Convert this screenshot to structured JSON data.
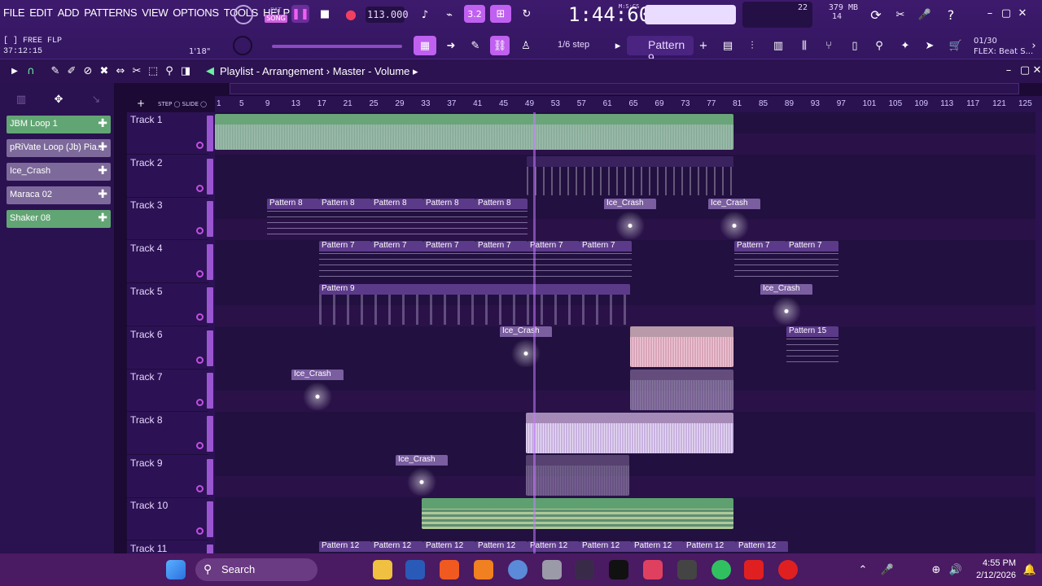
{
  "menu": [
    "FILE",
    "EDIT",
    "ADD",
    "PATTERNS",
    "VIEW",
    "OPTIONS",
    "TOOLS",
    "HELP"
  ],
  "transport": {
    "mode_top": "PAT",
    "mode_bottom": "SONG",
    "tempo": "113.000",
    "time": "1:44:60",
    "time_label": "M:S:CS",
    "time_format": "3.2",
    "cpu_top": "22",
    "ram": "379 MB",
    "ram_low": "14"
  },
  "hint": {
    "line1": "[  ] FREE FLP",
    "line2": "37:12:15",
    "line3": "1'18\""
  },
  "snap": {
    "step": "1/6 step",
    "pattern": "Pattern 9"
  },
  "news": {
    "count": "01/30",
    "text": "FLEX: Beat S..."
  },
  "playlist": {
    "breadcrumb_1": "Playlist - Arrangement",
    "breadcrumb_2": "Master - Volume"
  },
  "picker": [
    {
      "name": "JBM Loop 1"
    },
    {
      "name": "pRiVate Loop (Jb) Pia..."
    },
    {
      "name": "Ice_Crash"
    },
    {
      "name": "Maraca 02"
    },
    {
      "name": "Shaker 08"
    }
  ],
  "ruler": [
    "1",
    "5",
    "9",
    "13",
    "17",
    "21",
    "25",
    "29",
    "33",
    "37",
    "41",
    "45",
    "49",
    "53",
    "57",
    "61",
    "65",
    "69",
    "73",
    "77",
    "81",
    "85",
    "89",
    "93",
    "97",
    "101",
    "105",
    "109",
    "113",
    "117",
    "121",
    "125"
  ],
  "tracks": [
    "Track 1",
    "Track 2",
    "Track 3",
    "Track 4",
    "Track 5",
    "Track 6",
    "Track 7",
    "Track 8",
    "Track 9",
    "Track 10",
    "Track 11"
  ],
  "clips": {
    "p8": "Pattern 8",
    "p7": "Pattern 7",
    "p9": "Pattern 9",
    "p15": "Pattern 15",
    "p12": "Pattern 12",
    "ice": "Ice_Crash"
  },
  "taskbar": {
    "search": "Search",
    "time": "4:55 PM",
    "date": "2/12/2026"
  },
  "colors": {
    "accent": "#c060f0",
    "audio": "#6aa57a",
    "bg": "#221040"
  }
}
